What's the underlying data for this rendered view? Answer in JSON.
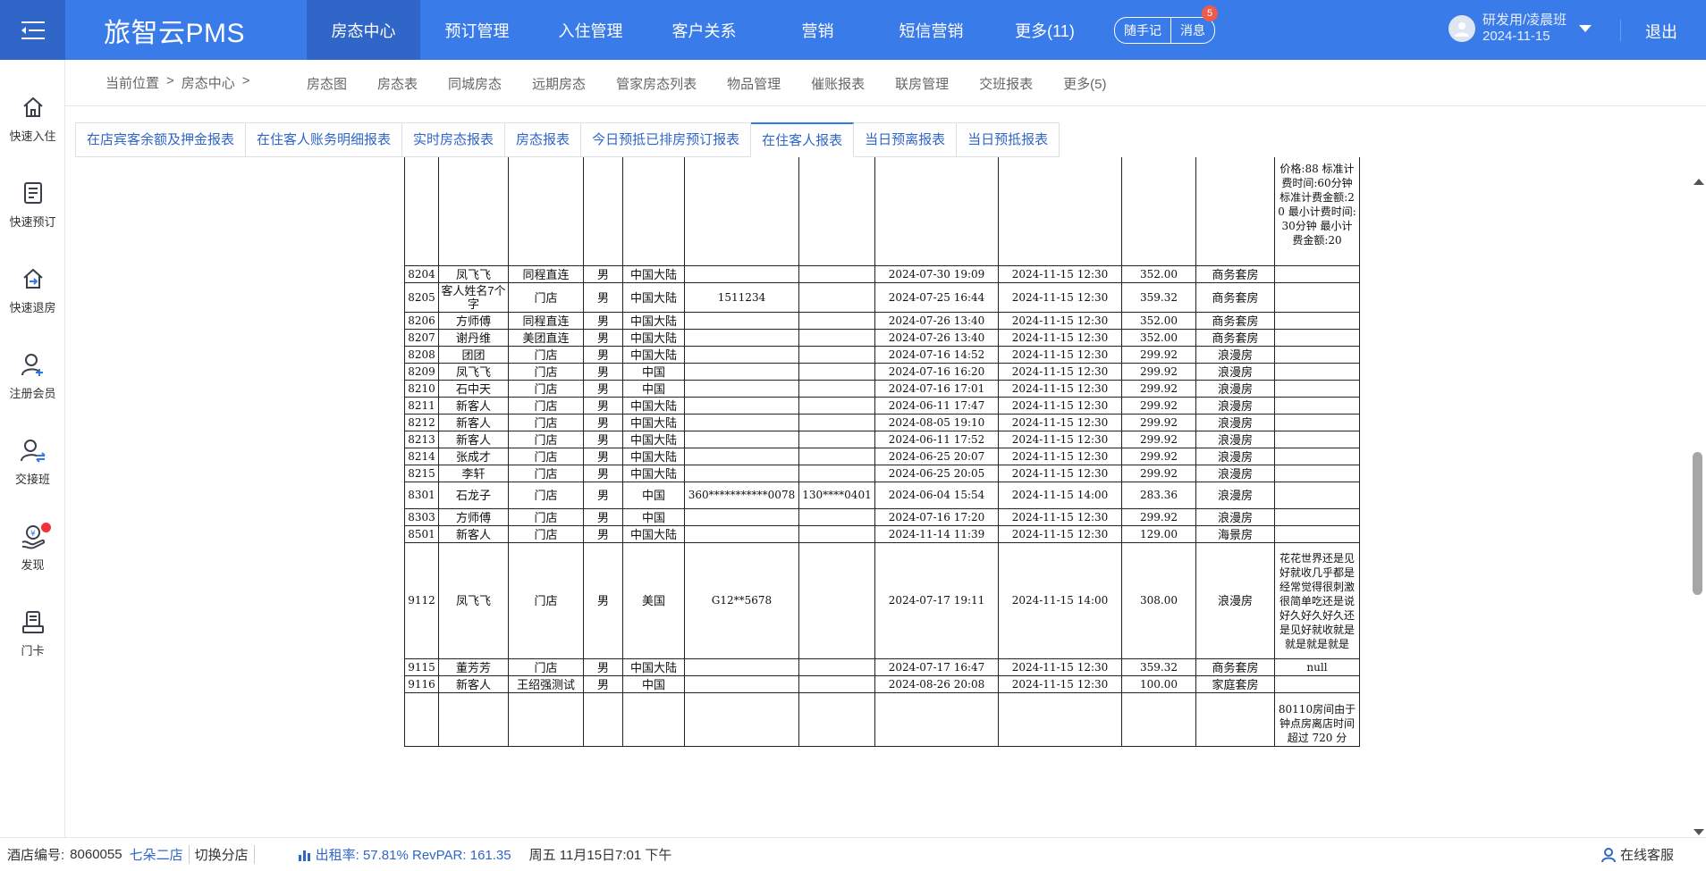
{
  "app": {
    "brand": "旅智云PMS",
    "logout": "退出",
    "user": {
      "name": "研发用/凌晨班",
      "date": "2024-11-15"
    }
  },
  "topnav": [
    {
      "label": "房态中心",
      "active": true
    },
    {
      "label": "预订管理"
    },
    {
      "label": "入住管理"
    },
    {
      "label": "客户关系"
    },
    {
      "label": "营销"
    },
    {
      "label": "短信营销"
    },
    {
      "label": "更多(11)"
    }
  ],
  "pills": {
    "notes": "随手记",
    "messages": "消息",
    "messages_badge": "5"
  },
  "sidebar": [
    {
      "label": "快速入住",
      "icon": "home-icon"
    },
    {
      "label": "快速预订",
      "icon": "book-icon"
    },
    {
      "label": "快速退房",
      "icon": "checkout-icon"
    },
    {
      "label": "注册会员",
      "icon": "add-user-icon"
    },
    {
      "label": "交接班",
      "icon": "shift-icon"
    },
    {
      "label": "发现",
      "icon": "discover-icon"
    },
    {
      "label": "门卡",
      "icon": "card-icon"
    }
  ],
  "breadcrumb": {
    "label": "当前位置",
    "sep": ">",
    "current": "房态中心",
    "sep2": ">"
  },
  "subnav": [
    "房态图",
    "房态表",
    "同城房态",
    "远期房态",
    "管家房态列表",
    "物品管理",
    "催账报表",
    "联房管理",
    "交班报表",
    "更多(5)"
  ],
  "tabs": [
    {
      "label": "在店宾客余额及押金报表"
    },
    {
      "label": "在住客人账务明细报表"
    },
    {
      "label": "实时房态报表"
    },
    {
      "label": "房态报表"
    },
    {
      "label": "今日预抵已排房预订报表"
    },
    {
      "label": "在住客人报表",
      "active": true
    },
    {
      "label": "当日预离报表"
    },
    {
      "label": "当日预抵报表"
    }
  ],
  "report": {
    "top_note": "价格:88 标准计费时间:60分钟 标准计费金额:20 最小计费时间:30分钟 最小计费金额:20",
    "rows": [
      {
        "room": "8204",
        "name": "凤飞飞",
        "source": "同程直连",
        "sex": "男",
        "region": "中国大陆",
        "id": "",
        "phone": "",
        "checkin": "2024-07-30 19:09",
        "checkout": "2024-11-15 12:30",
        "price": "352.00",
        "type": "商务套房",
        "note": ""
      },
      {
        "room": "8205",
        "name": "客人姓名7个字",
        "source": "门店",
        "sex": "男",
        "region": "中国大陆",
        "id": "1511234",
        "phone": "",
        "checkin": "2024-07-25 16:44",
        "checkout": "2024-11-15 12:30",
        "price": "359.32",
        "type": "商务套房",
        "note": ""
      },
      {
        "room": "8206",
        "name": "方师傅",
        "source": "同程直连",
        "sex": "男",
        "region": "中国大陆",
        "id": "",
        "phone": "",
        "checkin": "2024-07-26 13:40",
        "checkout": "2024-11-15 12:30",
        "price": "352.00",
        "type": "商务套房",
        "note": ""
      },
      {
        "room": "8207",
        "name": "谢丹维",
        "source": "美团直连",
        "sex": "男",
        "region": "中国大陆",
        "id": "",
        "phone": "",
        "checkin": "2024-07-26 13:40",
        "checkout": "2024-11-15 12:30",
        "price": "352.00",
        "type": "商务套房",
        "note": ""
      },
      {
        "room": "8208",
        "name": "团团",
        "source": "门店",
        "sex": "男",
        "region": "中国大陆",
        "id": "",
        "phone": "",
        "checkin": "2024-07-16 14:52",
        "checkout": "2024-11-15 12:30",
        "price": "299.92",
        "type": "浪漫房",
        "note": ""
      },
      {
        "room": "8209",
        "name": "凤飞飞",
        "source": "门店",
        "sex": "男",
        "region": "中国",
        "id": "",
        "phone": "",
        "checkin": "2024-07-16 16:20",
        "checkout": "2024-11-15 12:30",
        "price": "299.92",
        "type": "浪漫房",
        "note": ""
      },
      {
        "room": "8210",
        "name": "石中天",
        "source": "门店",
        "sex": "男",
        "region": "中国",
        "id": "",
        "phone": "",
        "checkin": "2024-07-16 17:01",
        "checkout": "2024-11-15 12:30",
        "price": "299.92",
        "type": "浪漫房",
        "note": ""
      },
      {
        "room": "8211",
        "name": "新客人",
        "source": "门店",
        "sex": "男",
        "region": "中国大陆",
        "id": "",
        "phone": "",
        "checkin": "2024-06-11 17:47",
        "checkout": "2024-11-15 12:30",
        "price": "299.92",
        "type": "浪漫房",
        "note": ""
      },
      {
        "room": "8212",
        "name": "新客人",
        "source": "门店",
        "sex": "男",
        "region": "中国大陆",
        "id": "",
        "phone": "",
        "checkin": "2024-08-05 19:10",
        "checkout": "2024-11-15 12:30",
        "price": "299.92",
        "type": "浪漫房",
        "note": ""
      },
      {
        "room": "8213",
        "name": "新客人",
        "source": "门店",
        "sex": "男",
        "region": "中国大陆",
        "id": "",
        "phone": "",
        "checkin": "2024-06-11 17:52",
        "checkout": "2024-11-15 12:30",
        "price": "299.92",
        "type": "浪漫房",
        "note": ""
      },
      {
        "room": "8214",
        "name": "张成才",
        "source": "门店",
        "sex": "男",
        "region": "中国大陆",
        "id": "",
        "phone": "",
        "checkin": "2024-06-25 20:07",
        "checkout": "2024-11-15 12:30",
        "price": "299.92",
        "type": "浪漫房",
        "note": ""
      },
      {
        "room": "8215",
        "name": "李轩",
        "source": "门店",
        "sex": "男",
        "region": "中国大陆",
        "id": "",
        "phone": "",
        "checkin": "2024-06-25 20:05",
        "checkout": "2024-11-15 12:30",
        "price": "299.92",
        "type": "浪漫房",
        "note": ""
      },
      {
        "room": "8301",
        "name": "石龙子",
        "source": "门店",
        "sex": "男",
        "region": "中国",
        "id": "360***********0078",
        "phone": "130****0401",
        "checkin": "2024-06-04 15:54",
        "checkout": "2024-11-15 14:00",
        "price": "283.36",
        "type": "浪漫房",
        "note": ""
      },
      {
        "room": "8303",
        "name": "方师傅",
        "source": "门店",
        "sex": "男",
        "region": "中国",
        "id": "",
        "phone": "",
        "checkin": "2024-07-16 17:20",
        "checkout": "2024-11-15 12:30",
        "price": "299.92",
        "type": "浪漫房",
        "note": ""
      },
      {
        "room": "8501",
        "name": "新客人",
        "source": "门店",
        "sex": "男",
        "region": "中国大陆",
        "id": "",
        "phone": "",
        "checkin": "2024-11-14 11:39",
        "checkout": "2024-11-15 12:30",
        "price": "129.00",
        "type": "海景房",
        "note": ""
      },
      {
        "room": "9112",
        "name": "凤飞飞",
        "source": "门店",
        "sex": "男",
        "region": "美国",
        "id": "G12**5678",
        "phone": "",
        "checkin": "2024-07-17 19:11",
        "checkout": "2024-11-15 14:00",
        "price": "308.00",
        "type": "浪漫房",
        "note": "花花世界还是见好就收几乎都是经常觉得很刺激很简单吃还是说好久好久好久还是见好就收就是就是就是就是"
      },
      {
        "room": "9115",
        "name": "董芳芳",
        "source": "门店",
        "sex": "男",
        "region": "中国大陆",
        "id": "",
        "phone": "",
        "checkin": "2024-07-17 16:47",
        "checkout": "2024-11-15 12:30",
        "price": "359.32",
        "type": "商务套房",
        "note": "null"
      },
      {
        "room": "9116",
        "name": "新客人",
        "source": "王绍强测试",
        "sex": "男",
        "region": "中国",
        "id": "",
        "phone": "",
        "checkin": "2024-08-26 20:08",
        "checkout": "2024-11-15 12:30",
        "price": "100.00",
        "type": "家庭套房",
        "note": ""
      }
    ],
    "bottom_note": "80110房间由于钟点房离店时间超过 720 分"
  },
  "status": {
    "hotel_no_label": "酒店编号:",
    "hotel_no": "8060055",
    "store": "七朵二店",
    "switch": "切换分店",
    "occupancy": "出租率: 57.81% RevPAR: 161.35",
    "datetime": "周五 11月15日7:01 下午",
    "service": "在线客服"
  }
}
